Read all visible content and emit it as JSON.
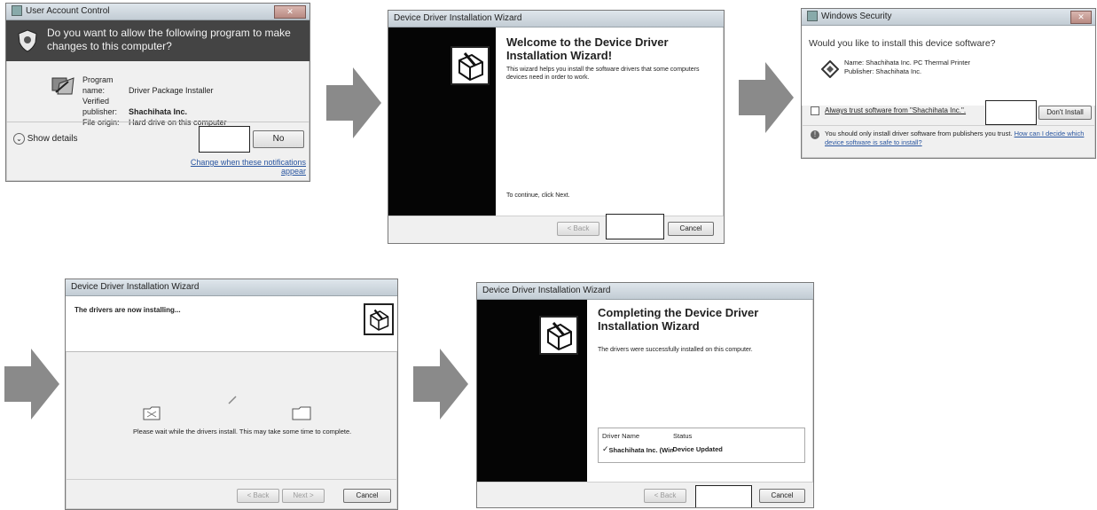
{
  "uac": {
    "title": "User Account Control",
    "question": "Do you want to allow the following program to make changes to this computer?",
    "program_name_label": "Program name:",
    "program_name_value": "Driver Package Installer",
    "publisher_label": "Verified publisher:",
    "publisher_value": "Shachihata Inc.",
    "origin_label": "File origin:",
    "origin_value": "Hard drive on this computer",
    "show_details": "Show details",
    "no_button": "No",
    "notifications_link": "Change when these notifications appear"
  },
  "welcome": {
    "title": "Device Driver Installation Wizard",
    "heading": "Welcome to the Device Driver Installation Wizard!",
    "body": "This wizard helps you install the software drivers that some computers devices need in order to work.",
    "continue_text": "To continue, click Next.",
    "back_button": "< Back",
    "cancel_button": "Cancel"
  },
  "security": {
    "title": "Windows Security",
    "question": "Would you like to install this device software?",
    "name_line": "Name: Shachihata Inc. PC Thermal Printer",
    "publisher_line": "Publisher: Shachihata Inc.",
    "always_trust": "Always trust software from \"Shachihata Inc.\".",
    "dont_install": "Don't Install",
    "warning": "You should only install driver software from publishers you trust.",
    "how_link": "How can I decide which device software is safe to install?"
  },
  "installing": {
    "title": "Device Driver Installation Wizard",
    "heading": "The drivers are now installing...",
    "message": "Please wait while the drivers install. This may take some time to complete.",
    "back_button": "< Back",
    "next_button": "Next >",
    "cancel_button": "Cancel"
  },
  "completing": {
    "title": "Device Driver Installation Wizard",
    "heading": "Completing the Device Driver Installation Wizard",
    "body": "The drivers were successfully installed on this computer.",
    "col_driver": "Driver Name",
    "col_status": "Status",
    "row_driver": "Shachihata Inc. (WinUsb)...",
    "row_status": "Device Updated",
    "back_button": "< Back",
    "cancel_button": "Cancel"
  },
  "colors": {
    "uac_header": "#444444",
    "arrow": "#8a8a8a",
    "panel": "#050505"
  }
}
